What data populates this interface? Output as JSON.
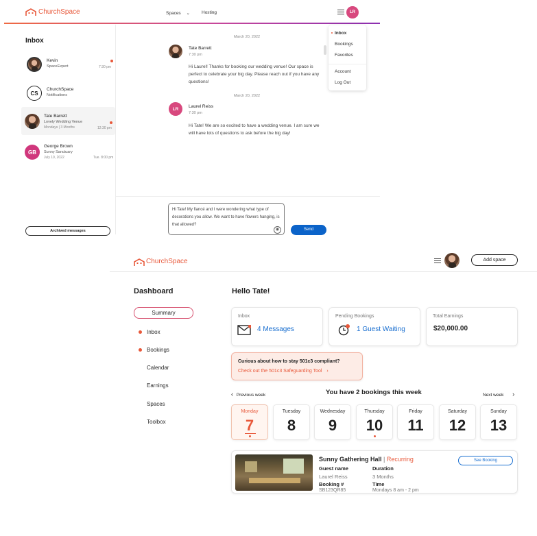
{
  "top": {
    "brand": "ChurchSpace",
    "nav": {
      "spaces": "Spaces",
      "hosting": "Hosting",
      "avatar_initials": "LR"
    },
    "inbox_title": "Inbox",
    "conversations": [
      {
        "name": "Kevin",
        "sub": "SpaceExpert",
        "time": "7:30 pm"
      },
      {
        "name": "ChurchSpace",
        "sub": "Notifications",
        "initials": "CS"
      },
      {
        "name": "Tate Barrett",
        "sub": "Lovely Wedding Venue",
        "meta": "Mondays | 3 Months",
        "time": "12:30 pm"
      },
      {
        "name": "George Brown",
        "sub": "Sunny Sanctuary",
        "meta": "July 10, 2022",
        "time": "Tue. 8:00 pm",
        "initials": "GB"
      }
    ],
    "archived_button": "Archived messages",
    "messages": [
      {
        "date": "March 20, 2022",
        "name": "Tate Barrett",
        "time": "7:30 pm",
        "text": "Hi Laurel! Thanks for booking our wedding venue! Our space is perfect to celebrate your big day. Please reach out if you have any questions!"
      },
      {
        "date": "March 20, 2022",
        "name": "Laurel Reiss",
        "time": "7:30 pm",
        "initials": "LR",
        "text": "Hi Tate! We are so excited to have a wedding venue. I am sure we will have lots of questions to ask before the big day!"
      }
    ],
    "compose_text": "Hi Tate! My fiancé and I were wondering what type of decorations you allow. We want to have flowers hanging, is that allowed?",
    "send_button": "Send",
    "menu": [
      "Inbox",
      "Bookings",
      "Favorites",
      "Account",
      "Log Out"
    ]
  },
  "dash": {
    "brand": "ChurchSpace",
    "add_space_button": "Add space",
    "sidebar_title": "Dashboard",
    "sidebar": [
      "Summary",
      "Inbox",
      "Bookings",
      "Calendar",
      "Earnings",
      "Spaces",
      "Toolbox"
    ],
    "greeting": "Hello Tate!",
    "cards": {
      "inbox": {
        "title": "Inbox",
        "value": "4 Messages"
      },
      "pending": {
        "title": "Pending Bookings",
        "value": "1 Guest Waiting"
      },
      "earnings": {
        "title": "Total Earnings",
        "value": "$20,000.00"
      }
    },
    "compliance": {
      "question": "Curious about how to stay 501c3 compliant?",
      "link": "Check out the 501c3 Safeguarding Tool"
    },
    "week": {
      "prev": "Previous week",
      "next": "Next week",
      "heading": "You have 2 bookings this week",
      "days": [
        {
          "name": "Monday",
          "num": "7"
        },
        {
          "name": "Tuesday",
          "num": "8"
        },
        {
          "name": "Wednesday",
          "num": "9"
        },
        {
          "name": "Thursday",
          "num": "10"
        },
        {
          "name": "Friday",
          "num": "11"
        },
        {
          "name": "Saturday",
          "num": "12"
        },
        {
          "name": "Sunday",
          "num": "13"
        }
      ]
    },
    "booking": {
      "venue": "Sunny Gathering Hall",
      "separator": "|",
      "tag": "Recurring",
      "see_button": "See Booking",
      "guest_label": "Guest name",
      "guest_value": "Laurel Reiss",
      "duration_label": "Duration",
      "duration_value": "3 Months",
      "booking_label": "Booking #",
      "booking_value": "SB123QR85",
      "time_label": "Time",
      "time_value": "Mondays 8 am - 2 pm"
    }
  },
  "colors": {
    "accent": "#e8583a",
    "blue": "#1a6fd0",
    "send": "#0b63c9",
    "gb": "#d0377c",
    "lr": "#d8487e"
  }
}
